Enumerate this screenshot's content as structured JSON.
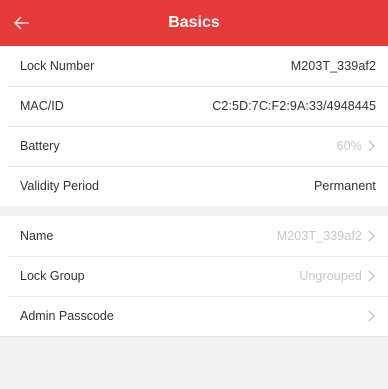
{
  "header": {
    "title": "Basics"
  },
  "info_rows": [
    {
      "label": "Lock Number",
      "value": "M203T_339af2"
    },
    {
      "label": "MAC/ID",
      "value": "C2:5D:7C:F2:9A:33/4948445"
    },
    {
      "label": "Battery",
      "value": "60%"
    },
    {
      "label": "Validity Period",
      "value": "Permanent"
    }
  ],
  "settings_rows": [
    {
      "label": "Name",
      "value": "M203T_339af2"
    },
    {
      "label": "Lock Group",
      "value": "Ungrouped"
    },
    {
      "label": "Admin Passcode",
      "value": ""
    }
  ],
  "colors": {
    "header": "#e5393a",
    "muted_text": "#c8c8c8"
  },
  "icons": {
    "back": "arrow-left-icon",
    "chevron": "chevron-right-icon"
  }
}
